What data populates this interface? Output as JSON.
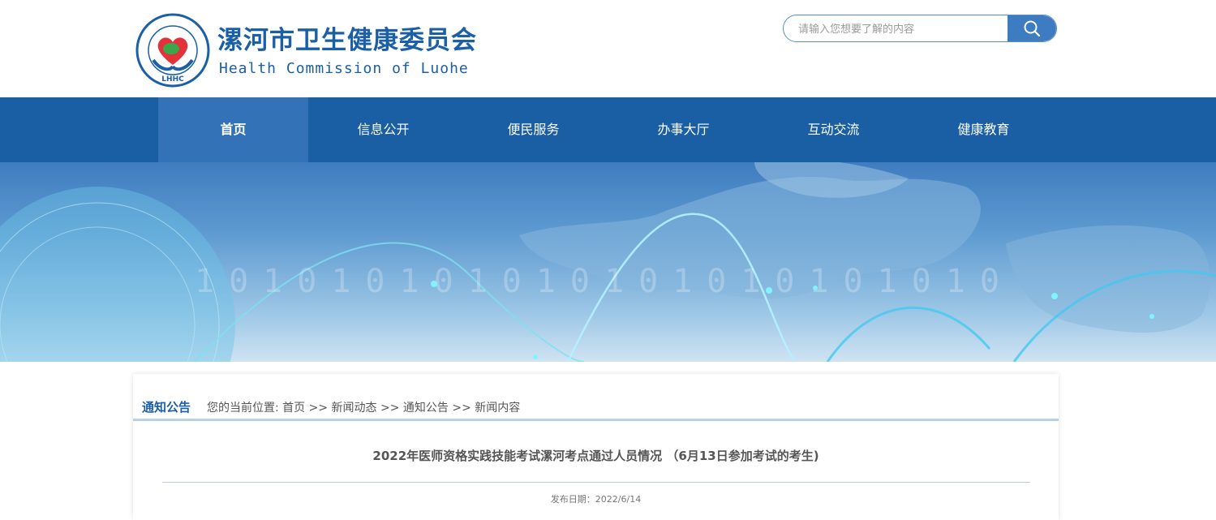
{
  "header": {
    "title_cn": "漯河市卫生健康委员会",
    "title_en": "Health Commission of Luohe",
    "logo_text": "漯河市卫生健康委员会",
    "logo_abbr": "LHHC"
  },
  "search": {
    "placeholder": "请输入您想要了解的内容"
  },
  "nav": {
    "items": [
      {
        "label": "首页"
      },
      {
        "label": "信息公开"
      },
      {
        "label": "便民服务"
      },
      {
        "label": "办事大厅"
      },
      {
        "label": "互动交流"
      },
      {
        "label": "健康教育"
      }
    ]
  },
  "banner": {
    "binary_text": "101010101010101010101010"
  },
  "breadcrumb": {
    "section": "通知公告",
    "prefix": "您的当前位置:",
    "items": [
      "首页",
      "新闻动态",
      "通知公告",
      "新闻内容"
    ],
    "separator": ">>"
  },
  "article": {
    "title": "2022年医师资格实践技能考试漯河考点通过人员情况 （6月13日参加考试的考生)",
    "publish_date": "发布日期：2022/6/14"
  },
  "colors": {
    "brand": "#1b5fa6",
    "nav_bg": "#1a5ea3",
    "nav_active": "#3472b8",
    "logo_red": "#e2333a",
    "logo_green": "#3aa74a"
  }
}
